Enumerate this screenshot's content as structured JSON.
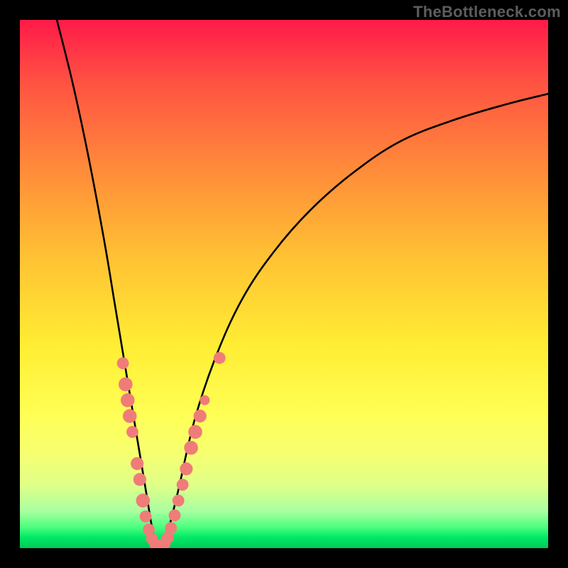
{
  "watermark": "TheBottleneck.com",
  "colors": {
    "page_bg": "#000000",
    "curve_stroke": "#000000",
    "dot_fill": "#ef7c79",
    "gradient_stops": [
      "#ff1a49",
      "#ff5342",
      "#ff8a3a",
      "#ffc233",
      "#ffee34",
      "#ffff56",
      "#f6ff70",
      "#e0ff88",
      "#a9ffa0",
      "#4dff7f",
      "#00e865",
      "#00c95a"
    ]
  },
  "chart_data": {
    "type": "line",
    "title": "",
    "xlabel": "",
    "ylabel": "",
    "xlim": [
      0,
      100
    ],
    "ylim": [
      0,
      100
    ],
    "note": "V-shaped bottleneck curve (percent value vs percent position). Approximate points read from gradient bands; minimum at x≈26, y≈0.",
    "curve": [
      {
        "x": 7,
        "y": 100
      },
      {
        "x": 10,
        "y": 88
      },
      {
        "x": 13,
        "y": 74
      },
      {
        "x": 16,
        "y": 58
      },
      {
        "x": 18,
        "y": 46
      },
      {
        "x": 20,
        "y": 34
      },
      {
        "x": 22,
        "y": 22
      },
      {
        "x": 24,
        "y": 10
      },
      {
        "x": 25,
        "y": 4
      },
      {
        "x": 26,
        "y": 0
      },
      {
        "x": 27,
        "y": 0
      },
      {
        "x": 28,
        "y": 3
      },
      {
        "x": 30,
        "y": 11
      },
      {
        "x": 33,
        "y": 24
      },
      {
        "x": 37,
        "y": 36
      },
      {
        "x": 42,
        "y": 47
      },
      {
        "x": 48,
        "y": 56
      },
      {
        "x": 55,
        "y": 64
      },
      {
        "x": 63,
        "y": 71
      },
      {
        "x": 72,
        "y": 77
      },
      {
        "x": 82,
        "y": 81
      },
      {
        "x": 92,
        "y": 84
      },
      {
        "x": 100,
        "y": 86
      }
    ],
    "highlight_dots": [
      {
        "x": 19.5,
        "y": 35,
        "r": 1.2
      },
      {
        "x": 20.0,
        "y": 31,
        "r": 1.4
      },
      {
        "x": 20.4,
        "y": 28,
        "r": 1.4
      },
      {
        "x": 20.8,
        "y": 25,
        "r": 1.4
      },
      {
        "x": 21.3,
        "y": 22,
        "r": 1.2
      },
      {
        "x": 22.2,
        "y": 16,
        "r": 1.3
      },
      {
        "x": 22.7,
        "y": 13,
        "r": 1.3
      },
      {
        "x": 23.3,
        "y": 9,
        "r": 1.4
      },
      {
        "x": 23.8,
        "y": 6,
        "r": 1.2
      },
      {
        "x": 24.4,
        "y": 3.5,
        "r": 1.2
      },
      {
        "x": 25.0,
        "y": 1.8,
        "r": 1.2
      },
      {
        "x": 25.6,
        "y": 0.8,
        "r": 1.2
      },
      {
        "x": 26.2,
        "y": 0.3,
        "r": 1.2
      },
      {
        "x": 26.8,
        "y": 0.3,
        "r": 1.2
      },
      {
        "x": 27.4,
        "y": 0.9,
        "r": 1.2
      },
      {
        "x": 28.0,
        "y": 2.0,
        "r": 1.2
      },
      {
        "x": 28.6,
        "y": 3.8,
        "r": 1.2
      },
      {
        "x": 29.3,
        "y": 6.2,
        "r": 1.2
      },
      {
        "x": 30.0,
        "y": 9.0,
        "r": 1.2
      },
      {
        "x": 30.8,
        "y": 12,
        "r": 1.2
      },
      {
        "x": 31.5,
        "y": 15,
        "r": 1.3
      },
      {
        "x": 32.4,
        "y": 19,
        "r": 1.4
      },
      {
        "x": 33.2,
        "y": 22,
        "r": 1.4
      },
      {
        "x": 34.1,
        "y": 25,
        "r": 1.3
      },
      {
        "x": 35.0,
        "y": 28,
        "r": 1.0
      },
      {
        "x": 37.8,
        "y": 36,
        "r": 1.2
      }
    ]
  }
}
